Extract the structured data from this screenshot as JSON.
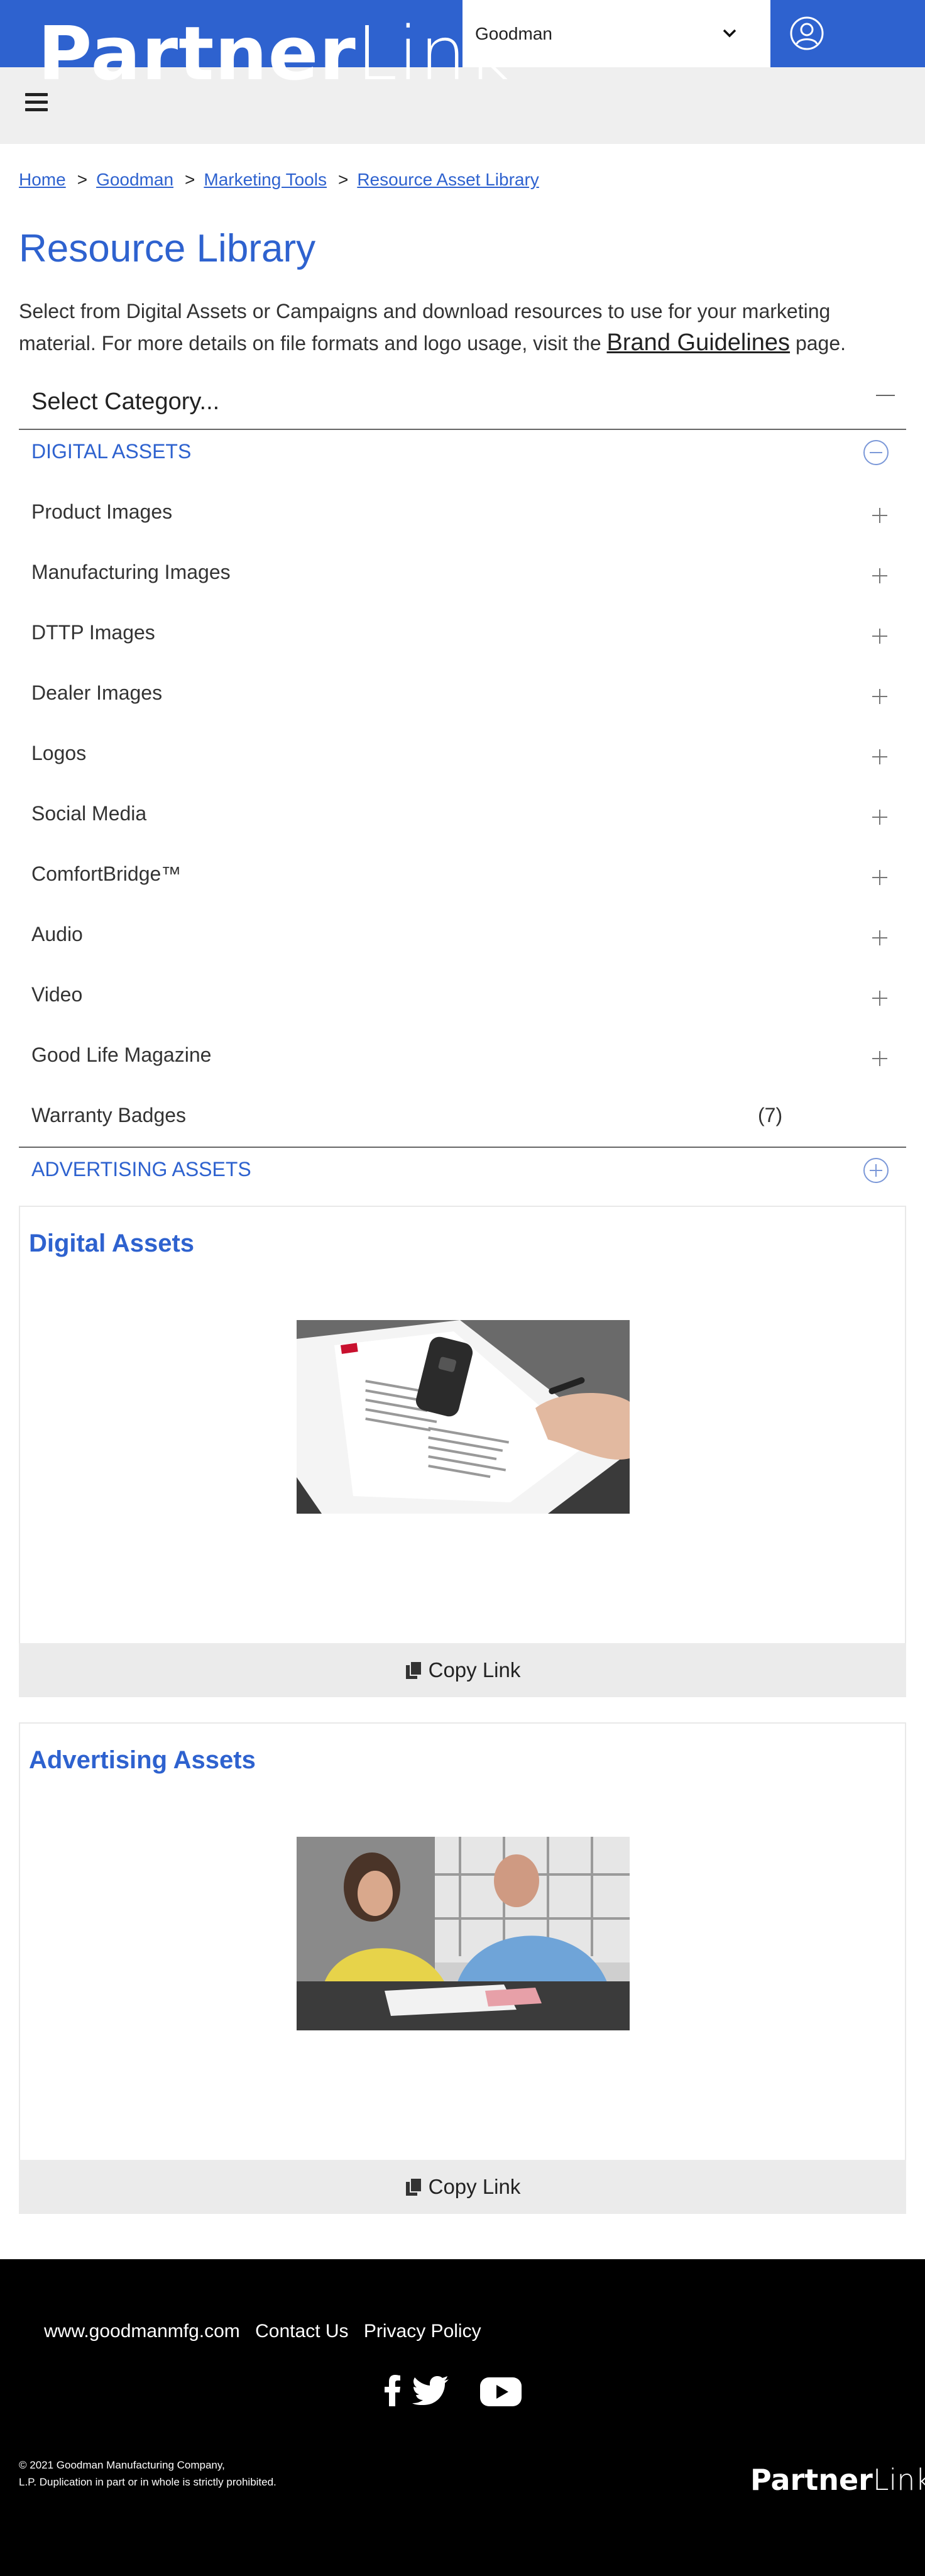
{
  "header": {
    "logo_bold": "Partner",
    "logo_light": "Link",
    "brand_select_value": "Goodman"
  },
  "breadcrumb": [
    "Home",
    "Goodman",
    "Marketing Tools",
    "Resource Asset Library"
  ],
  "breadcrumb_sep": ">",
  "page_title": "Resource Library",
  "intro": {
    "text_before": "Select from Digital Assets or Campaigns and download resources to use for your marketing material. For more details on file formats and logo usage, visit the ",
    "link": "Brand Guidelines",
    "text_after": " page."
  },
  "accordion": {
    "select_label": "Select Category...",
    "digital_section": "DIGITAL ASSETS",
    "categories": [
      "Product Images",
      "Manufacturing Images",
      "DTTP Images",
      "Dealer Images",
      "Logos",
      "Social Media",
      "ComfortBridge™",
      "Audio",
      "Video",
      "Good Life Magazine",
      "Warranty Badges"
    ],
    "warranty_count": "(7)",
    "advertising_section": "ADVERTISING ASSETS"
  },
  "cards": [
    {
      "title": "Digital Assets",
      "copy_label": "Copy Link"
    },
    {
      "title": "Advertising Assets",
      "copy_label": "Copy Link"
    }
  ],
  "footer": {
    "links": [
      "www.goodmanmfg.com",
      "Contact Us",
      "Privacy Policy"
    ],
    "copyright_line1": "© 2021 Goodman Manufacturing Company,",
    "copyright_line2": "L.P. Duplication in part or in whole is strictly prohibited.",
    "logo_bold": "Partner",
    "logo_light": "Link"
  },
  "colors": {
    "brand_blue": "#2e62cf",
    "header_gray": "#efefef",
    "footer_black": "#000000"
  }
}
